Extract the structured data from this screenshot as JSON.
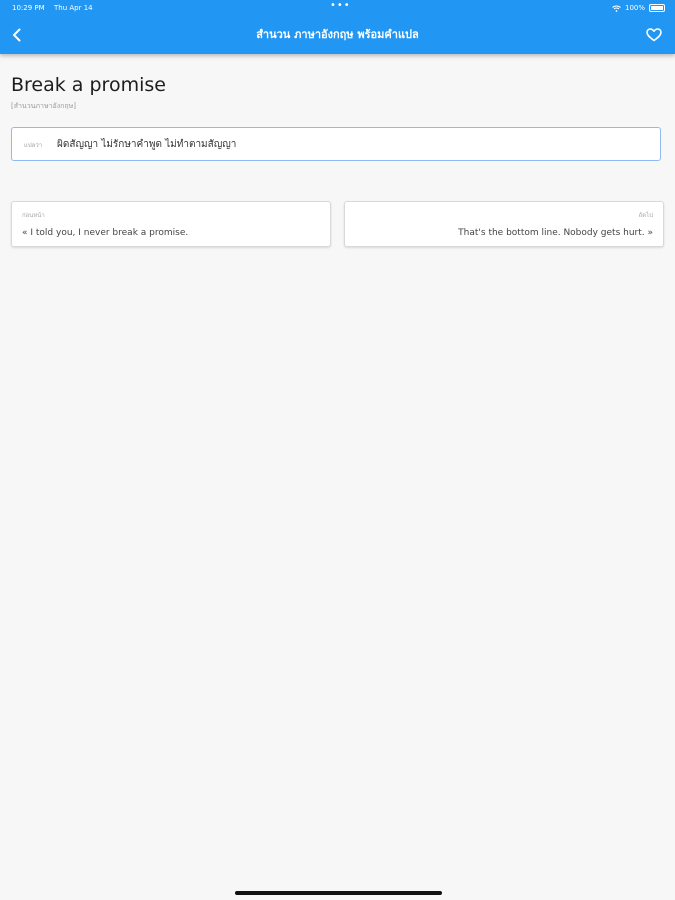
{
  "status_bar": {
    "time": "10:29 PM",
    "date": "Thu Apr 14",
    "dots": "•••",
    "battery": "100%"
  },
  "app_bar": {
    "title": "สำนวน ภาษาอังกฤษ พร้อมคำแปล",
    "color": "#2196f3",
    "back_icon": "chevron-left-icon",
    "favorite_icon": "heart-outline-icon"
  },
  "entry": {
    "headword": "Break a promise",
    "category": "[สำนวนภาษาอังกฤษ]",
    "meaning_label": "แปลว่า",
    "meaning_text": "ผิดสัญญา ไม่รักษาคำพูด ไม่ทำตามสัญญา"
  },
  "navigation": {
    "previous": {
      "label": "ก่อนหน้า",
      "text": "« I told you, I never break a promise."
    },
    "next": {
      "label": "ถัดไป",
      "text": "That's the bottom line. Nobody gets hurt. »"
    }
  }
}
